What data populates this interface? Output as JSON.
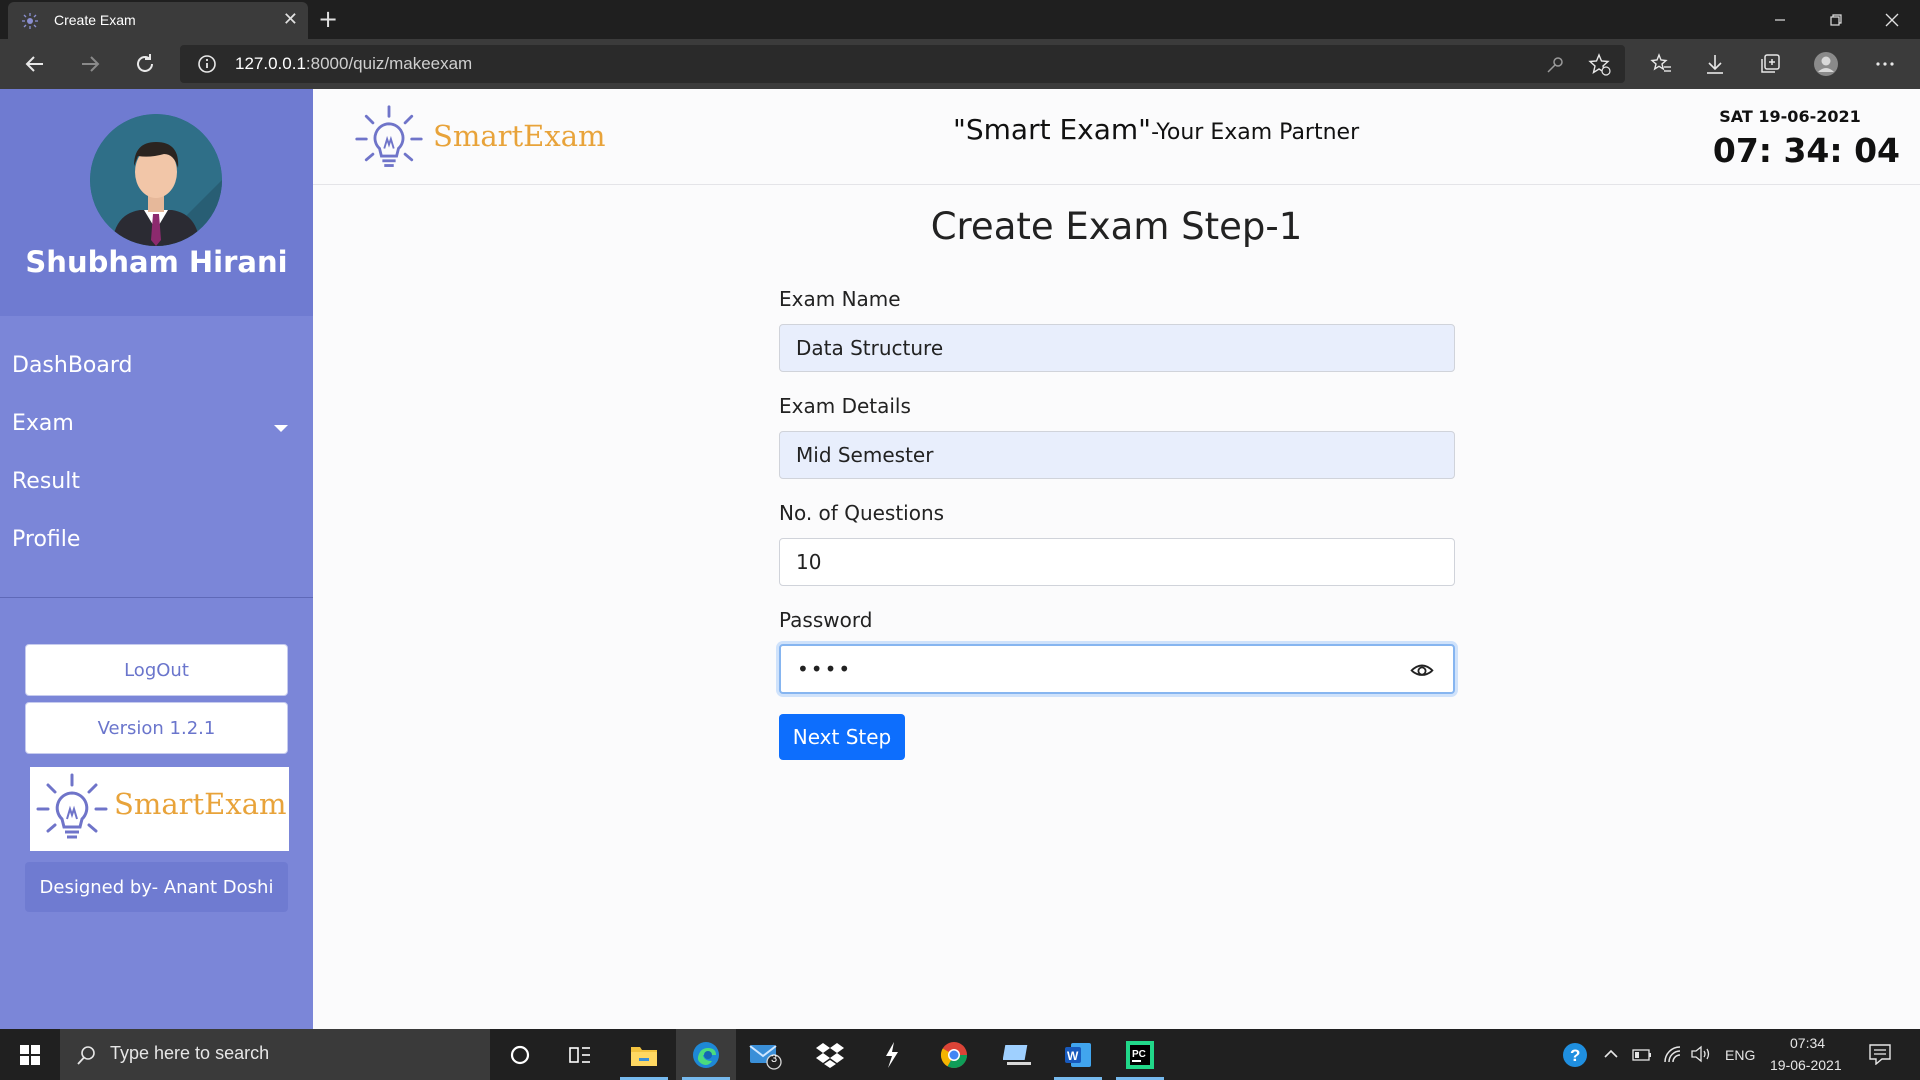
{
  "browser": {
    "tab_title": "Create Exam",
    "url_host": "127.0.0.1",
    "url_rest": ":8000/quiz/makeexam"
  },
  "sidebar": {
    "user_name": "Shubham Hirani",
    "nav": [
      {
        "label": "DashBoard",
        "icon": "none"
      },
      {
        "label": "Exam",
        "icon": "caret-down-icon"
      },
      {
        "label": "Result",
        "icon": "none"
      },
      {
        "label": "Profile",
        "icon": "none"
      }
    ],
    "logout_label": "LogOut",
    "version_label": "Version 1.2.1",
    "logo_text": "SmartExam",
    "designed_by": "Designed by- Anant Doshi"
  },
  "header": {
    "logo_text": "SmartExam",
    "tagline_main": "\"Smart Exam\"",
    "tagline_sub": "-Your Exam Partner",
    "clock_date": "SAT 19-06-2021",
    "clock_time": "07: 34: 04"
  },
  "form": {
    "title": "Create Exam Step-1",
    "exam_name_label": "Exam Name",
    "exam_name_value": "Data Structure",
    "exam_details_label": "Exam Details",
    "exam_details_value": "Mid Semester",
    "questions_label": "No. of Questions",
    "questions_value": "10",
    "password_label": "Password",
    "password_value": "••••",
    "next_label": "Next Step"
  },
  "taskbar": {
    "search_placeholder": "Type here to search",
    "mail_badge": "3",
    "lang": "ENG",
    "time": "07:34",
    "date": "19-06-2021"
  },
  "colors": {
    "sidebar": "#7b86d8",
    "sidebar_dark": "#6f7bd1",
    "primary_button": "#0d6efd",
    "logo_orange": "#e8a33a",
    "logo_purple": "#6f74c9"
  }
}
